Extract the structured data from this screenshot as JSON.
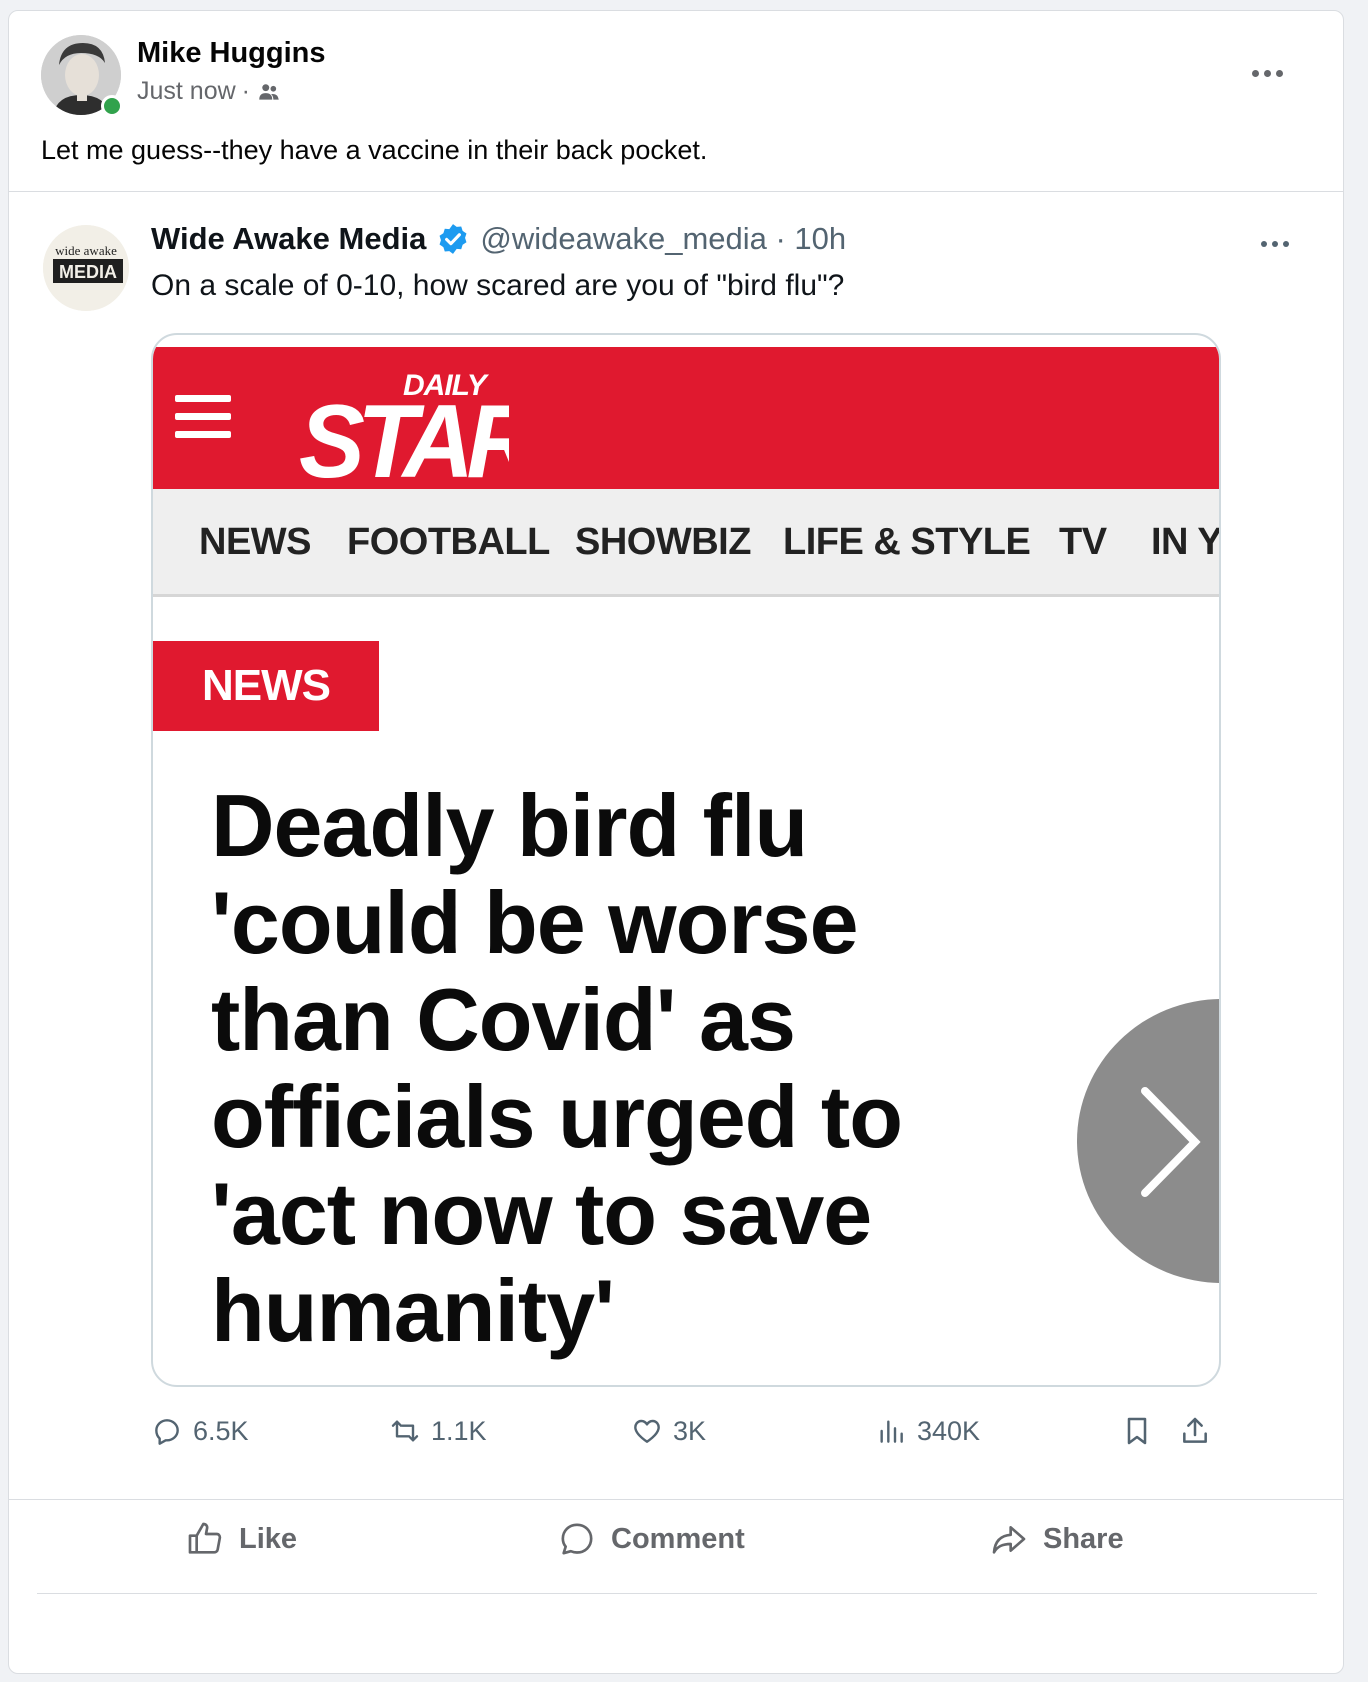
{
  "post": {
    "author": "Mike Huggins",
    "time": "Just now",
    "separator": "·",
    "audience_icon": "friends-icon",
    "text": "Let me guess--they have a vaccine in their back pocket."
  },
  "tweet": {
    "display_name": "Wide Awake Media",
    "handle_time": "@wideawake_media · 10h",
    "avatar_top": "wide awake",
    "avatar_bottom": "MEDIA",
    "text": "On a scale of 0-10, how scared are you of \"bird flu\"?",
    "media": {
      "logo_small": "DAILY",
      "logo_big": "STAR",
      "nav": [
        "NEWS",
        "FOOTBALL",
        "SHOWBIZ",
        "LIFE & STYLE",
        "TV",
        "IN Y"
      ],
      "tag": "NEWS",
      "headline_lines": [
        "Deadly bird flu",
        "'could be worse",
        "than Covid' as",
        "officials urged to",
        "'act now to save",
        "humanity'"
      ]
    },
    "stats": {
      "replies": "6.5K",
      "reposts": "1.1K",
      "likes": "3K",
      "views": "340K"
    }
  },
  "actions": {
    "like": "Like",
    "comment": "Comment",
    "share": "Share"
  },
  "colors": {
    "daily_star_red": "#e0192f",
    "online_green": "#31a24c",
    "verified_blue": "#1d9bf0"
  }
}
